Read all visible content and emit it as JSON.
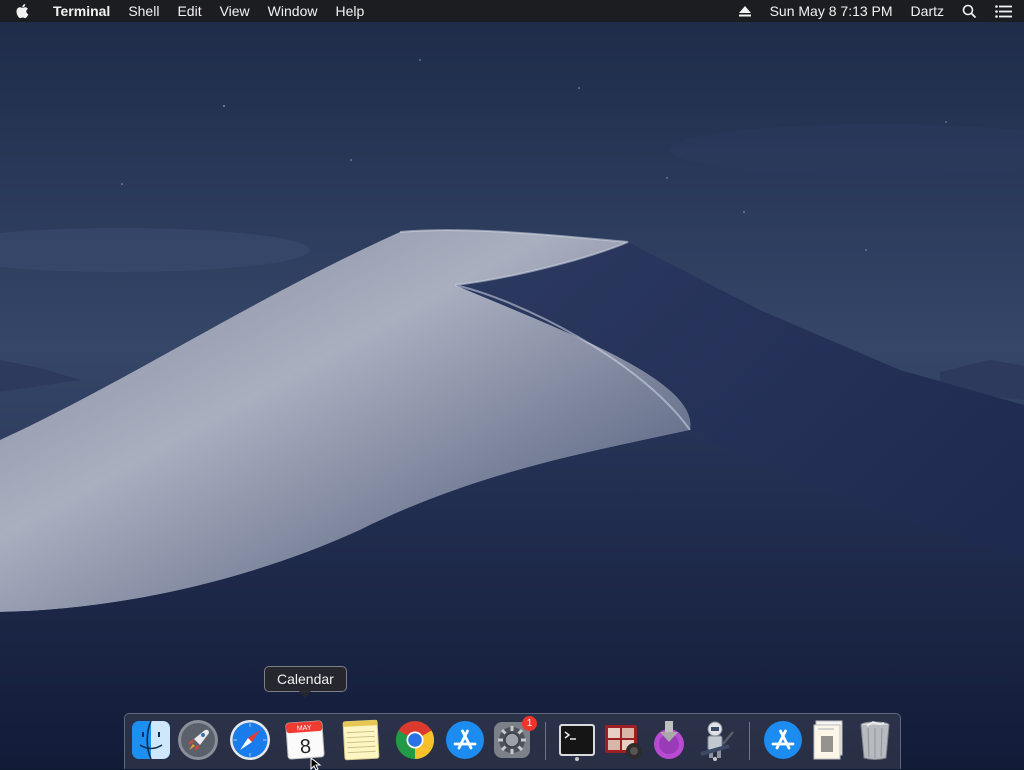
{
  "menubar": {
    "app_name": "Terminal",
    "menus": [
      "Shell",
      "Edit",
      "View",
      "Window",
      "Help"
    ],
    "clock": "Sun May 8  7:13 PM",
    "user": "Dartz",
    "icons": [
      "apple-icon",
      "eject-icon",
      "spotlight-search-icon",
      "notification-center-icon"
    ]
  },
  "tooltip": {
    "text": "Calendar"
  },
  "dock": {
    "calendar": {
      "month": "MAY",
      "day": "8"
    },
    "system_preferences_badge": "1",
    "apps": [
      "finder",
      "launchpad",
      "safari",
      "calendar",
      "notes",
      "chrome",
      "app-store",
      "system-preferences",
      "terminal",
      "photo-booth",
      "disk-utility",
      "automator",
      "app-store-folder",
      "documents-folder",
      "trash"
    ]
  },
  "colors": {
    "menubar": "#1c1c1e",
    "sky": "#1d2c4e",
    "dune_light": "#aeb4c4",
    "dune_dark": "#2a3656"
  }
}
